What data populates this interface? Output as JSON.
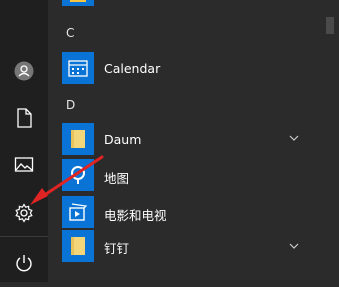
{
  "sections": [
    {
      "letter": "C",
      "apps": [
        {
          "name": "Calendar"
        }
      ]
    },
    {
      "letter": "D",
      "apps": [
        {
          "name": "Daum",
          "expandable": true
        },
        {
          "name": "地图"
        },
        {
          "name": "电影和电视"
        },
        {
          "name": "钉钉",
          "expandable": true
        }
      ]
    }
  ],
  "rail_icons": [
    "user-icon",
    "document-icon",
    "pictures-icon",
    "settings-icon",
    "power-icon"
  ],
  "colors": {
    "accent": "#0a74d6",
    "folder": "#f4d67a",
    "annotation_red": "#e02424"
  }
}
